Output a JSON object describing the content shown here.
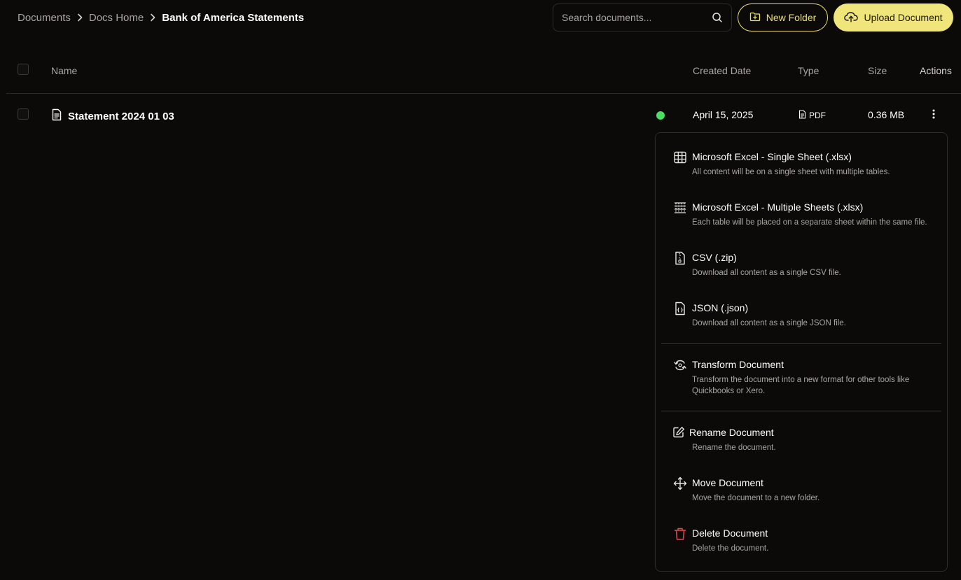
{
  "breadcrumb": {
    "items": [
      "Documents",
      "Docs Home"
    ],
    "current": "Bank of America Statements"
  },
  "search": {
    "placeholder": "Search documents..."
  },
  "toolbar": {
    "new_folder_label": "New Folder",
    "upload_label": "Upload Document"
  },
  "table": {
    "columns": {
      "name": "Name",
      "created_date": "Created Date",
      "type": "Type",
      "size": "Size",
      "actions": "Actions"
    },
    "rows": [
      {
        "name": "Statement 2024 01 03",
        "status_color": "#4ade63",
        "created_date": "April 15, 2025",
        "type": "PDF",
        "size": "0.36 MB"
      }
    ]
  },
  "menu": {
    "items": [
      {
        "icon": "table-icon",
        "title": "Microsoft Excel - Single Sheet (.xlsx)",
        "description": "All content will be on a single sheet with multiple tables."
      },
      {
        "icon": "sheets-icon",
        "title": "Microsoft Excel - Multiple Sheets (.xlsx)",
        "description": "Each table will be placed on a separate sheet within the same file."
      },
      {
        "icon": "file-zip-icon",
        "title": "CSV (.zip)",
        "description": "Download all content as a single CSV file."
      },
      {
        "icon": "file-json-icon",
        "title": "JSON (.json)",
        "description": "Download all content as a single JSON file."
      },
      {
        "icon": "transform-icon",
        "title": "Transform Document",
        "description": "Transform the document into a new format for other tools like Quickbooks or Xero."
      },
      {
        "icon": "edit-icon",
        "title": "Rename Document",
        "description": "Rename the document."
      },
      {
        "icon": "move-icon",
        "title": "Move Document",
        "description": "Move the document to a new folder."
      },
      {
        "icon": "trash-icon",
        "title": "Delete Document",
        "description": "Delete the document."
      }
    ]
  },
  "colors": {
    "background": "#0b0a09",
    "accent": "#f0e57a",
    "status_ok": "#4ade63",
    "danger": "#e5484d"
  }
}
